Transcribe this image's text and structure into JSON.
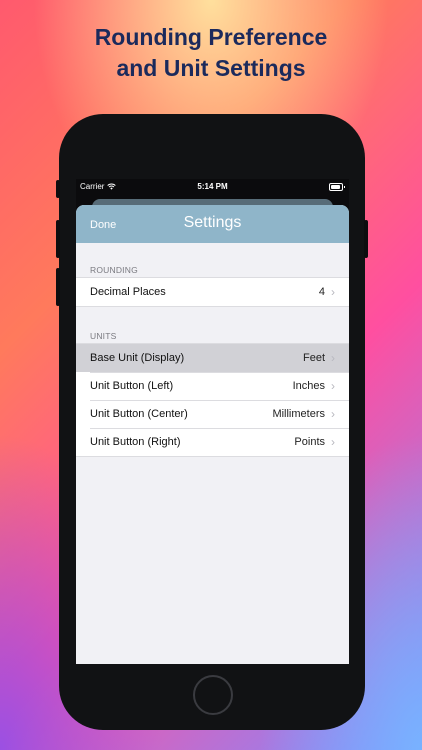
{
  "headline": [
    "Rounding Preference",
    "and Unit Settings"
  ],
  "status": {
    "carrier": "Carrier",
    "time": "5:14 PM"
  },
  "nav": {
    "done": "Done",
    "title": "Settings"
  },
  "sections": [
    {
      "header": "ROUNDING",
      "rows": [
        {
          "label": "Decimal Places",
          "value": "4"
        }
      ]
    },
    {
      "header": "UNITS",
      "rows": [
        {
          "label": "Base Unit (Display)",
          "value": "Feet",
          "selected": true
        },
        {
          "label": "Unit Button (Left)",
          "value": "Inches"
        },
        {
          "label": "Unit Button (Center)",
          "value": "Millimeters"
        },
        {
          "label": "Unit Button (Right)",
          "value": "Points"
        }
      ]
    }
  ],
  "colors": {
    "navbar": "#8fb5c9",
    "headline": "#1b2a5c",
    "selected_row": "#d1d1d6"
  },
  "icons": {
    "wifi": "wifi-icon",
    "battery": "battery-icon",
    "chevron": "chevron-right-icon"
  }
}
